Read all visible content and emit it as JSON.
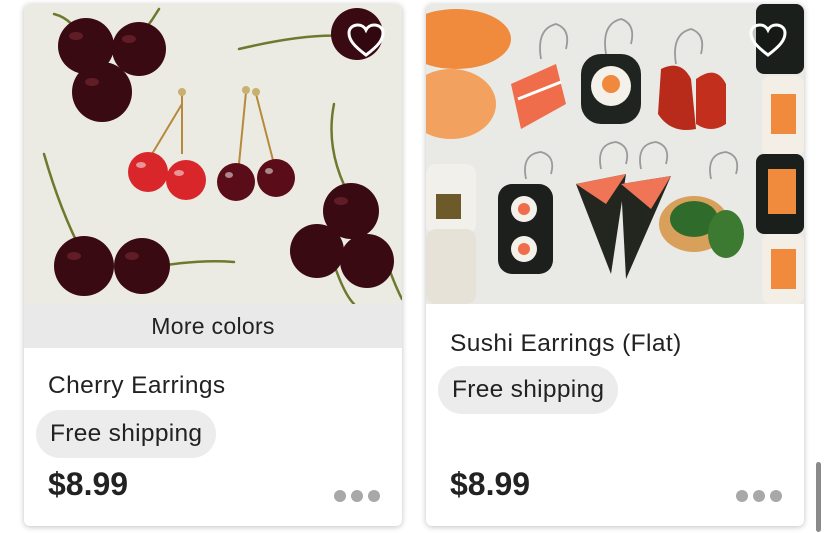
{
  "listings": [
    {
      "title": "Cherry Earrings",
      "badge": "More colors",
      "shipping": "Free shipping",
      "price": "$8.99",
      "favorite_icon": "heart-outline-icon",
      "more_icon": "more-dots-icon"
    },
    {
      "title": "Sushi Earrings (Flat)",
      "shipping": "Free shipping",
      "price": "$8.99",
      "favorite_icon": "heart-outline-icon",
      "more_icon": "more-dots-icon"
    }
  ],
  "colors": {
    "text": "#222222",
    "pill_bg": "#ececec",
    "banner_bg": "#e9e9e9",
    "dots": "#a8a8a8"
  }
}
